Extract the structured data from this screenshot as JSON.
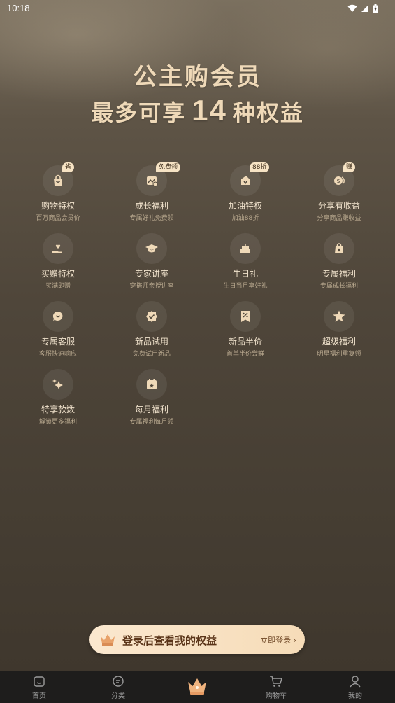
{
  "status_bar": {
    "time": "10:18"
  },
  "hero": {
    "title": "公主购会员",
    "sub_prefix": "最多可享",
    "sub_number": "14",
    "sub_suffix": "种权益"
  },
  "benefits": [
    {
      "title": "购物特权",
      "sub": "百万商品会员价",
      "badge": "省",
      "icon": "bag-icon"
    },
    {
      "title": "成长福利",
      "sub": "专属好礼免费领",
      "badge": "免费领",
      "icon": "growth-icon"
    },
    {
      "title": "加油特权",
      "sub": "加油88折",
      "badge": "88折",
      "icon": "fuel-icon"
    },
    {
      "title": "分享有收益",
      "sub": "分享商品赚收益",
      "badge": "赚",
      "icon": "coin-icon"
    },
    {
      "title": "买赠特权",
      "sub": "买满即赠",
      "badge": "",
      "icon": "gift-hand-icon"
    },
    {
      "title": "专家讲座",
      "sub": "穿搭师亲授讲座",
      "badge": "",
      "icon": "graduation-cap-icon"
    },
    {
      "title": "生日礼",
      "sub": "生日当月享好礼",
      "badge": "",
      "icon": "birthday-cake-icon"
    },
    {
      "title": "专属福利",
      "sub": "专属成长福利",
      "badge": "",
      "icon": "lock-bag-icon"
    },
    {
      "title": "专属客服",
      "sub": "客服快速响应",
      "badge": "",
      "icon": "chat-icon"
    },
    {
      "title": "新品试用",
      "sub": "免费试用新品",
      "badge": "",
      "icon": "verified-badge-icon"
    },
    {
      "title": "新品半价",
      "sub": "首单半价尝鲜",
      "badge": "",
      "icon": "coupon-icon"
    },
    {
      "title": "超级福利",
      "sub": "明星福利重复领",
      "badge": "",
      "icon": "star-icon"
    },
    {
      "title": "特享款数",
      "sub": "解锁更多福利",
      "badge": "",
      "icon": "sparkle-icon"
    },
    {
      "title": "每月福利",
      "sub": "专属福利每月领",
      "badge": "",
      "icon": "calendar-icon"
    }
  ],
  "login_bar": {
    "text": "登录后查看我的权益",
    "link": "立即登录"
  },
  "tabbar": {
    "tabs": [
      {
        "label": "首页",
        "icon": "home-icon"
      },
      {
        "label": "分类",
        "icon": "category-icon"
      },
      {
        "label": "",
        "icon": "crown-icon"
      },
      {
        "label": "购物车",
        "icon": "cart-icon"
      },
      {
        "label": "我的",
        "icon": "profile-icon"
      }
    ]
  },
  "colors": {
    "accent": "#efd9b8",
    "login_bar": "#fbe8cf",
    "tabbar_bg": "#1e1d1c"
  }
}
